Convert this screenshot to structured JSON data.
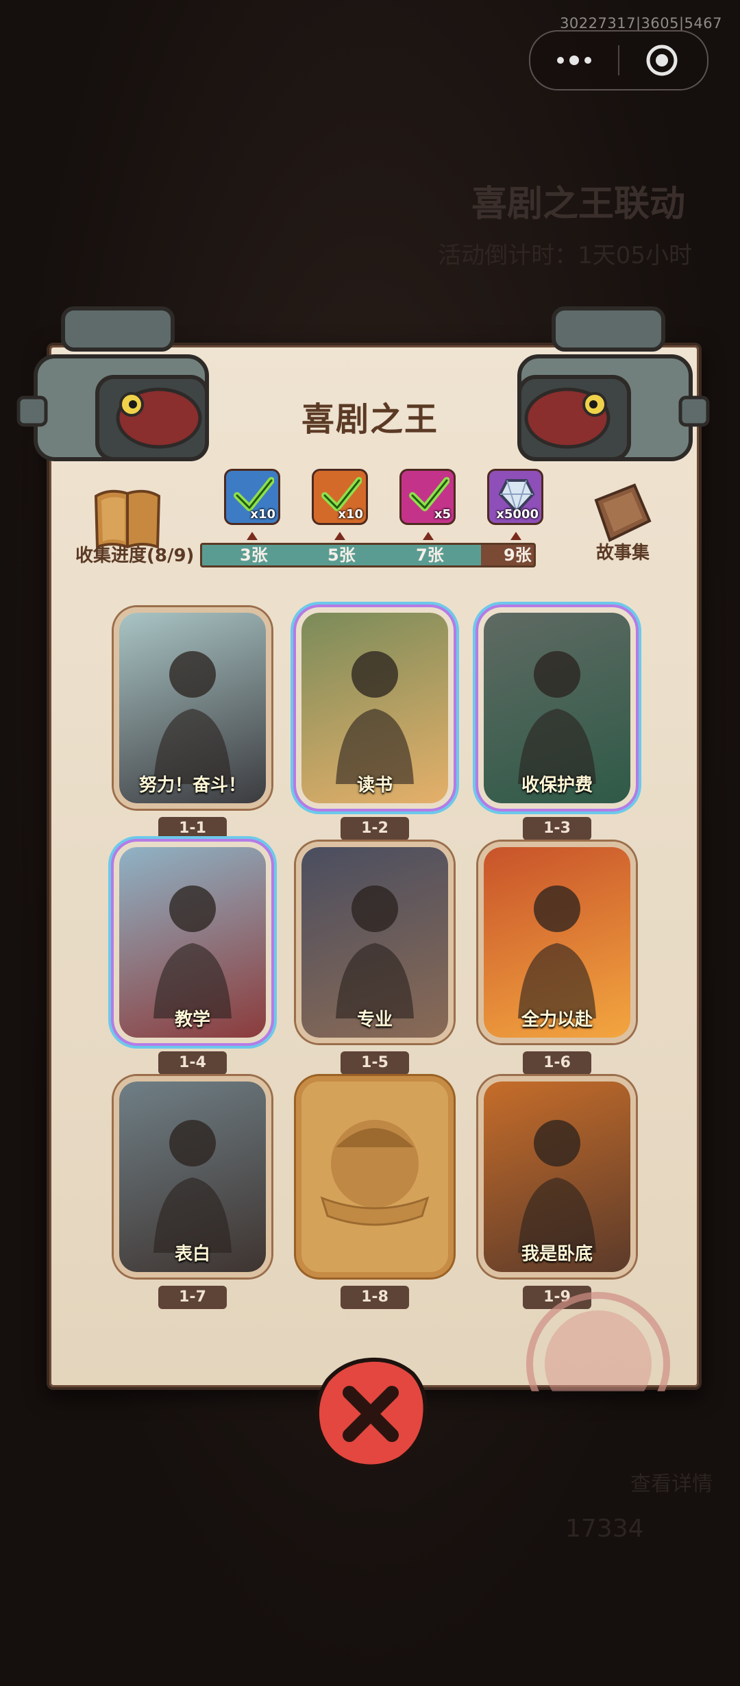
{
  "system": {
    "info_text": "30227317|3605|5467"
  },
  "background": {
    "event_title": "喜剧之王联动",
    "countdown_text": "活动倒计时：1天05小时",
    "hint_text": "查看详情",
    "currency_count": "17334"
  },
  "panel": {
    "title": "喜剧之王",
    "collection_label": "收集进度(8/9)",
    "progress": {
      "collected": 8,
      "total": 9,
      "fill_fraction": 0.84
    },
    "story_label": "故事集",
    "rewards": [
      {
        "qty": "x10",
        "threshold": "3张",
        "color": "#3d7cc4",
        "claimed": true,
        "icon": "check-icon"
      },
      {
        "qty": "x10",
        "threshold": "5张",
        "color": "#d46a2a",
        "claimed": true,
        "icon": "check-icon"
      },
      {
        "qty": "x5",
        "threshold": "7张",
        "color": "#c4338a",
        "claimed": true,
        "icon": "check-icon"
      },
      {
        "qty": "x5000",
        "threshold": "9张",
        "color": "#8e4fb8",
        "claimed": false,
        "icon": "diamond-icon"
      }
    ],
    "cards": [
      {
        "id": "1-1",
        "title": "努力！奋斗！",
        "rarity": "normal",
        "colors": [
          "#a9c4c4",
          "#3b3b3f"
        ]
      },
      {
        "id": "1-2",
        "title": "读书",
        "rarity": "rare",
        "colors": [
          "#7a8b5a",
          "#e5b06a"
        ]
      },
      {
        "id": "1-3",
        "title": "收保护费",
        "rarity": "rare",
        "colors": [
          "#5f6a63",
          "#2f5a48"
        ]
      },
      {
        "id": "1-4",
        "title": "教学",
        "rarity": "rare",
        "colors": [
          "#8fb3c6",
          "#8c3b3b"
        ]
      },
      {
        "id": "1-5",
        "title": "专业",
        "rarity": "normal",
        "colors": [
          "#4a4e60",
          "#8a6a55"
        ]
      },
      {
        "id": "1-6",
        "title": "全力以赴",
        "rarity": "normal",
        "colors": [
          "#c8532a",
          "#f3a640"
        ]
      },
      {
        "id": "1-7",
        "title": "表白",
        "rarity": "normal",
        "colors": [
          "#6f7f86",
          "#3e3430"
        ]
      },
      {
        "id": "1-8",
        "title": "",
        "rarity": "locked",
        "colors": [
          "#d5a25a",
          "#b9823e"
        ]
      },
      {
        "id": "1-9",
        "title": "我是卧底",
        "rarity": "normal",
        "colors": [
          "#c66d2a",
          "#5b3a2a"
        ]
      }
    ]
  },
  "controls": {
    "close_icon": "close-x-icon"
  }
}
